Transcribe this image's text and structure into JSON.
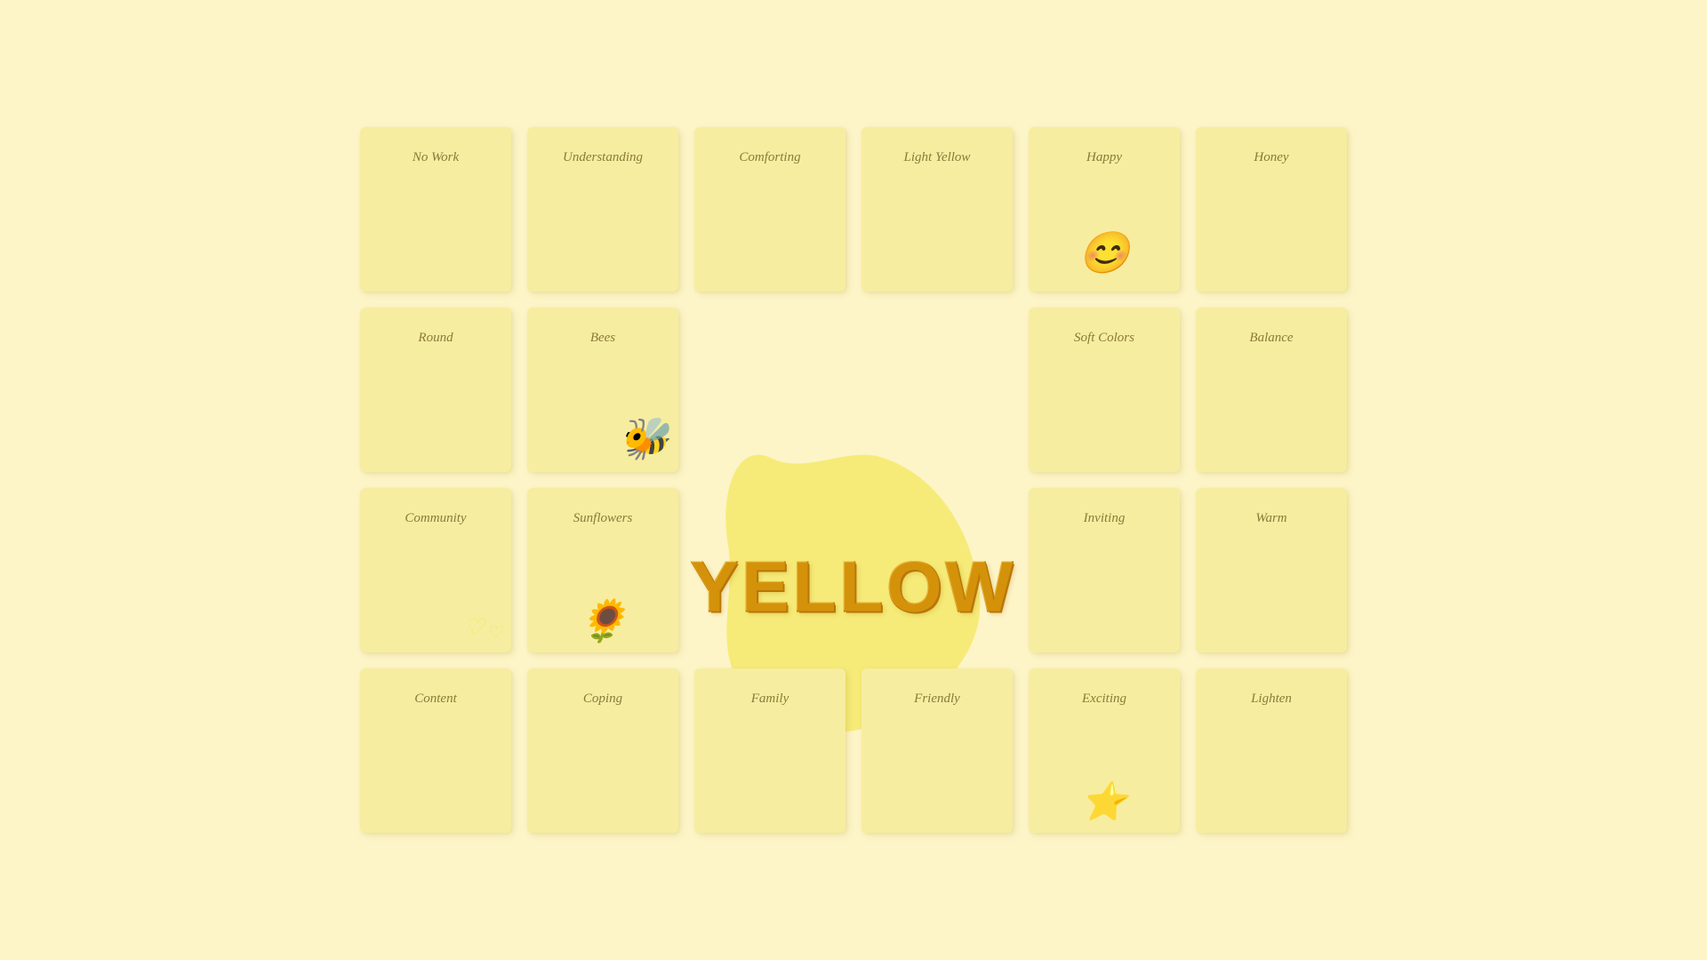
{
  "title": "YELLOW",
  "bg_color": "#fdf5c8",
  "accent_color": "#d4920a",
  "notes": [
    {
      "id": "no-work",
      "label": "No Work",
      "emoji": null,
      "col": 1,
      "row": 1
    },
    {
      "id": "understanding",
      "label": "Understanding",
      "emoji": null,
      "col": 2,
      "row": 1
    },
    {
      "id": "comforting",
      "label": "Comforting",
      "emoji": null,
      "col": 3,
      "row": 1
    },
    {
      "id": "light-yellow",
      "label": "Light Yellow",
      "emoji": null,
      "col": 4,
      "row": 1
    },
    {
      "id": "happy",
      "label": "Happy",
      "emoji": "😊",
      "col": 5,
      "row": 1
    },
    {
      "id": "honey",
      "label": "Honey",
      "emoji": null,
      "col": 6,
      "row": 1
    },
    {
      "id": "round",
      "label": "Round",
      "emoji": null,
      "col": 1,
      "row": 2
    },
    {
      "id": "bees",
      "label": "Bees",
      "emoji": "🐝",
      "col": 2,
      "row": 2
    },
    {
      "id": "soft-colors",
      "label": "Soft Colors",
      "emoji": null,
      "col": 5,
      "row": 2
    },
    {
      "id": "balance",
      "label": "Balance",
      "emoji": null,
      "col": 6,
      "row": 2
    },
    {
      "id": "community",
      "label": "Community",
      "emoji": "hearts",
      "col": 1,
      "row": 3
    },
    {
      "id": "sunflowers",
      "label": "Sunflowers",
      "emoji": "🌻",
      "col": 2,
      "row": 3
    },
    {
      "id": "inviting",
      "label": "Inviting",
      "emoji": null,
      "col": 5,
      "row": 3
    },
    {
      "id": "warm",
      "label": "Warm",
      "emoji": null,
      "col": 6,
      "row": 3
    },
    {
      "id": "content",
      "label": "Content",
      "emoji": null,
      "col": 1,
      "row": 4
    },
    {
      "id": "coping",
      "label": "Coping",
      "emoji": null,
      "col": 2,
      "row": 4
    },
    {
      "id": "family",
      "label": "Family",
      "emoji": null,
      "col": 3,
      "row": 4
    },
    {
      "id": "friendly",
      "label": "Friendly",
      "emoji": null,
      "col": 4,
      "row": 4
    },
    {
      "id": "exciting",
      "label": "Exciting",
      "emoji": "⭐",
      "col": 5,
      "row": 4
    },
    {
      "id": "lighten",
      "label": "Lighten",
      "emoji": null,
      "col": 6,
      "row": 4
    }
  ],
  "center": {
    "title": "YELLOW",
    "col_start": 3,
    "col_end": 5,
    "row_start": 2,
    "row_end": 5
  }
}
